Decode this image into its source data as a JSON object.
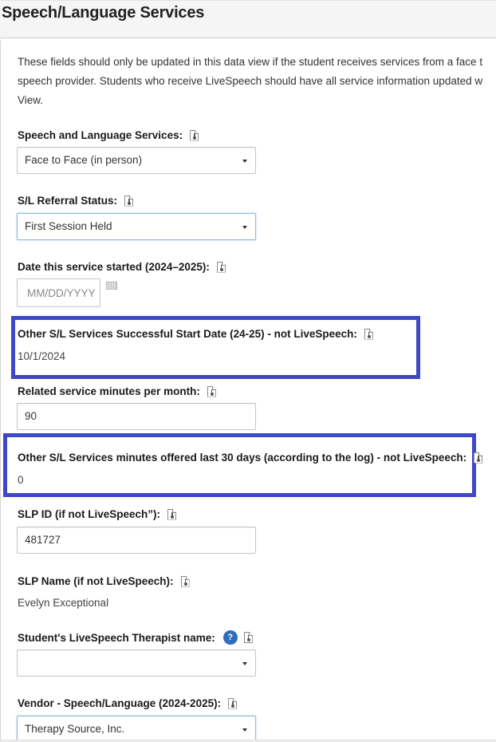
{
  "panel": {
    "title": "Speech/Language Services"
  },
  "intro": {
    "lines": [
      "These fields should only be updated in this data view if the student receives services from a face t",
      "speech provider. Students who receive LiveSpeech should have all service information updated w",
      "View."
    ]
  },
  "icons": {
    "field_doc": "document-info-icon",
    "calendar": "calendar-icon",
    "help": "?"
  },
  "fields": {
    "services": {
      "label": "Speech and Language Services:",
      "value": "Face to Face (in person)"
    },
    "referral_status": {
      "label": "S/L Referral Status:",
      "value": "First Session Held"
    },
    "date_started": {
      "label": "Date this service started (2024–2025):",
      "value": "",
      "placeholder": "MM/DD/YYYY"
    },
    "successful_start_date": {
      "label": "Other S/L Services Successful Start Date (24-25) - not LiveSpeech:",
      "value": "10/1/2024"
    },
    "minutes_per_month": {
      "label": "Related service minutes per month:",
      "value": "90"
    },
    "minutes_offered": {
      "label": "Other S/L Services minutes offered last 30 days (according to the log) - not LiveSpeech:",
      "value": "0"
    },
    "slp_id": {
      "label": "SLP ID (if not LiveSpeech”):",
      "value": "481727"
    },
    "slp_name": {
      "label": "SLP Name (if not LiveSpeech):",
      "value": "Evelyn Exceptional"
    },
    "therapist_name": {
      "label": "Student's LiveSpeech Therapist name:",
      "value": ""
    },
    "vendor": {
      "label": "Vendor - Speech/Language (2024-2025):",
      "value": "Therapy Source, Inc."
    }
  },
  "colors": {
    "highlight_border": "#3f48c7",
    "help_icon": "#2f6eba",
    "focus_border": "#8fb8e0"
  }
}
